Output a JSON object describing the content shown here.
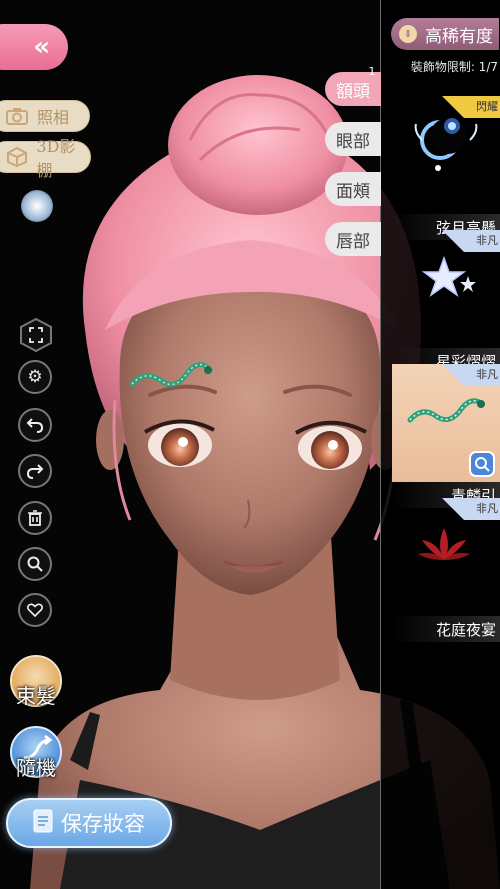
{
  "nav": {
    "back_glyph": "«"
  },
  "left_menu": {
    "photo_label": "照相",
    "studio_label": "3D影棚",
    "bun_label": "束髮",
    "random_label": "隨機",
    "save_label": "保存妝容"
  },
  "side_tools": [
    "fullscreen-icon",
    "settings-icon",
    "undo-icon",
    "redo-icon",
    "delete-icon",
    "search-icon",
    "heart-icon"
  ],
  "tabs": [
    {
      "label": "額頭",
      "active": true,
      "badge": "1"
    },
    {
      "label": "眼部",
      "active": false
    },
    {
      "label": "面頰",
      "active": false
    },
    {
      "label": "唇部",
      "active": false
    }
  ],
  "panel": {
    "sort_label": "高稀有度",
    "limit_text": "裝飾物限制: 1/7",
    "items": [
      {
        "name": "弦月高懸",
        "tag": "閃耀",
        "tag_color": "#f0c842",
        "selected": false
      },
      {
        "name": "星彩熠熠",
        "tag": "非凡",
        "tag_color": "#c9d8f2",
        "selected": false
      },
      {
        "name": "青麟引",
        "tag": "非凡",
        "tag_color": "#c9d8f2",
        "selected": true
      },
      {
        "name": "花庭夜宴",
        "tag": "非凡",
        "tag_color": "#c9d8f2",
        "selected": false
      }
    ]
  },
  "colors": {
    "accent_pink": "#ea6e94",
    "save_blue": "#6ba8e6",
    "hair": "#f29bb0"
  }
}
